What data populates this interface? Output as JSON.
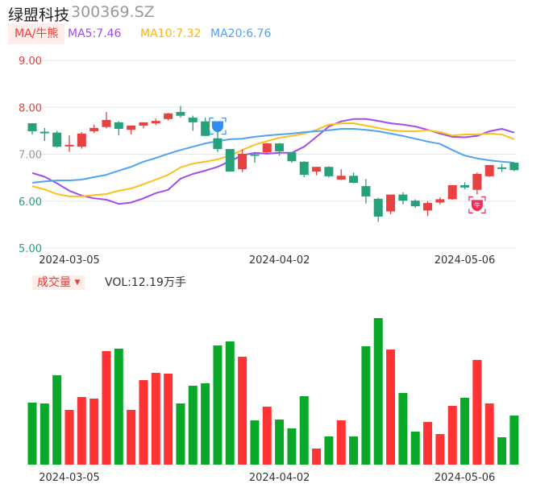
{
  "header": {
    "name": "绿盟科技",
    "code": "300369.SZ"
  },
  "ma_legend": {
    "tab_label": "MA/牛熊",
    "ma5": "MA5:7.46",
    "ma10": "MA10:7.32",
    "ma20": "MA20:6.76"
  },
  "volume_legend": {
    "tab_label": "成交量",
    "dropdown_icon": "caret-down-icon",
    "value": "VOL:12.19万手"
  },
  "colors": {
    "up": "#e84141",
    "down": "#26a17b",
    "ma5": "#a24cf0",
    "ma10": "#fbc11b",
    "ma20": "#4fa3f5",
    "vol_up": "#ff3333",
    "vol_down": "#0aa829"
  },
  "chart_data": [
    {
      "type": "candlestick",
      "ylim": [
        5,
        9
      ],
      "y_ticks": [
        "9.00",
        "8.00",
        "7.00",
        "6.00",
        "5.00"
      ],
      "y_tick_values": [
        9,
        8,
        7,
        6,
        5
      ],
      "x_ticks": [
        {
          "index": 3,
          "label": "2024-03-05"
        },
        {
          "index": 20,
          "label": "2024-04-02"
        },
        {
          "index": 35,
          "label": "2024-05-06"
        }
      ],
      "grid": "horizontal",
      "ohlc": [
        [
          7.66,
          7.66,
          7.42,
          7.49
        ],
        [
          7.48,
          7.56,
          7.28,
          7.46
        ],
        [
          7.46,
          7.5,
          7.14,
          7.16
        ],
        [
          7.19,
          7.4,
          7.05,
          7.2
        ],
        [
          7.16,
          7.47,
          7.12,
          7.44
        ],
        [
          7.49,
          7.63,
          7.45,
          7.56
        ],
        [
          7.58,
          7.9,
          7.55,
          7.73
        ],
        [
          7.68,
          7.7,
          7.4,
          7.54
        ],
        [
          7.52,
          7.61,
          7.42,
          7.61
        ],
        [
          7.61,
          7.68,
          7.55,
          7.68
        ],
        [
          7.66,
          7.76,
          7.62,
          7.71
        ],
        [
          7.75,
          7.88,
          7.72,
          7.87
        ],
        [
          7.9,
          8.03,
          7.78,
          7.82
        ],
        [
          7.78,
          7.82,
          7.5,
          7.68
        ],
        [
          7.7,
          7.78,
          7.39,
          7.39
        ],
        [
          7.34,
          7.53,
          7.05,
          7.11
        ],
        [
          7.11,
          7.11,
          6.63,
          6.63
        ],
        [
          6.68,
          7.1,
          6.62,
          7.01
        ],
        [
          7.0,
          7.02,
          6.82,
          6.99
        ],
        [
          7.04,
          7.24,
          7.0,
          7.23
        ],
        [
          7.23,
          7.24,
          6.97,
          7.06
        ],
        [
          7.04,
          7.05,
          6.82,
          6.85
        ],
        [
          6.84,
          6.85,
          6.51,
          6.56
        ],
        [
          6.63,
          6.73,
          6.55,
          6.73
        ],
        [
          6.73,
          6.74,
          6.5,
          6.53
        ],
        [
          6.46,
          6.68,
          6.45,
          6.54
        ],
        [
          6.54,
          6.61,
          6.38,
          6.39
        ],
        [
          6.32,
          6.47,
          5.95,
          6.1
        ],
        [
          6.05,
          6.07,
          5.56,
          5.67
        ],
        [
          5.78,
          6.14,
          5.72,
          6.14
        ],
        [
          6.14,
          6.19,
          5.93,
          6.01
        ],
        [
          6.01,
          6.04,
          5.86,
          5.89
        ],
        [
          5.8,
          6.0,
          5.68,
          5.96
        ],
        [
          5.97,
          6.08,
          5.93,
          6.04
        ],
        [
          6.04,
          6.34,
          6.03,
          6.34
        ],
        [
          6.34,
          6.4,
          6.25,
          6.29
        ],
        [
          6.24,
          6.61,
          6.14,
          6.58
        ],
        [
          6.53,
          6.77,
          6.52,
          6.77
        ],
        [
          6.72,
          6.79,
          6.62,
          6.71
        ],
        [
          6.82,
          6.83,
          6.64,
          6.66
        ]
      ],
      "ohlc_order": [
        "open",
        "high",
        "low",
        "close"
      ],
      "series": [
        {
          "name": "MA5",
          "values": [
            6.6,
            6.52,
            6.38,
            6.22,
            6.12,
            6.06,
            6.03,
            5.94,
            5.97,
            6.06,
            6.17,
            6.24,
            6.48,
            6.58,
            6.65,
            6.73,
            6.85,
            6.98,
            7.03,
            7.01,
            7.03,
            7.03,
            7.16,
            7.37,
            7.59,
            7.7,
            7.75,
            7.75,
            7.71,
            7.66,
            7.63,
            7.59,
            7.52,
            7.44,
            7.37,
            7.36,
            7.39,
            7.49,
            7.54,
            7.46
          ]
        },
        {
          "name": "MA10",
          "values": [
            6.32,
            6.25,
            6.15,
            6.1,
            6.1,
            6.13,
            6.15,
            6.22,
            6.27,
            6.36,
            6.46,
            6.56,
            6.72,
            6.8,
            6.84,
            6.89,
            6.97,
            7.09,
            7.2,
            7.28,
            7.35,
            7.39,
            7.44,
            7.52,
            7.63,
            7.66,
            7.66,
            7.61,
            7.56,
            7.51,
            7.49,
            7.49,
            7.51,
            7.47,
            7.4,
            7.42,
            7.42,
            7.44,
            7.42,
            7.32
          ]
        },
        {
          "name": "MA20",
          "values": [
            6.39,
            6.42,
            6.44,
            6.44,
            6.46,
            6.51,
            6.56,
            6.65,
            6.73,
            6.84,
            6.92,
            7.01,
            7.09,
            7.16,
            7.23,
            7.28,
            7.32,
            7.33,
            7.37,
            7.4,
            7.42,
            7.44,
            7.47,
            7.49,
            7.51,
            7.54,
            7.54,
            7.52,
            7.49,
            7.44,
            7.39,
            7.33,
            7.27,
            7.22,
            7.09,
            6.97,
            6.91,
            6.87,
            6.84,
            6.82
          ]
        }
      ],
      "annotations": [
        {
          "index": 15,
          "price": 7.6,
          "kind": "bear-signal",
          "color": "#2f8ff0",
          "text": ""
        },
        {
          "index": 36,
          "price": 5.92,
          "kind": "bull-signal",
          "color": "#f5285a",
          "text": "牛"
        }
      ]
    },
    {
      "type": "bar",
      "unit": "万手",
      "values": [
        15.4,
        15.2,
        22.2,
        13.6,
        16.8,
        16.4,
        28.2,
        28.8,
        13.6,
        21.0,
        22.8,
        22.6,
        15.2,
        19.6,
        20.2,
        29.6,
        30.6,
        26.8,
        11.0,
        14.4,
        11.2,
        9.0,
        17.0,
        4.0,
        7.0,
        11.0,
        7.0,
        29.4,
        36.4,
        28.6,
        17.8,
        8.2,
        10.6,
        7.6,
        14.6,
        16.6,
        26.0,
        15.2,
        6.8,
        12.19
      ],
      "x_ticks": [
        {
          "index": 3,
          "label": "2024-03-05"
        },
        {
          "index": 20,
          "label": "2024-04-02"
        },
        {
          "index": 35,
          "label": "2024-05-06"
        }
      ]
    }
  ]
}
